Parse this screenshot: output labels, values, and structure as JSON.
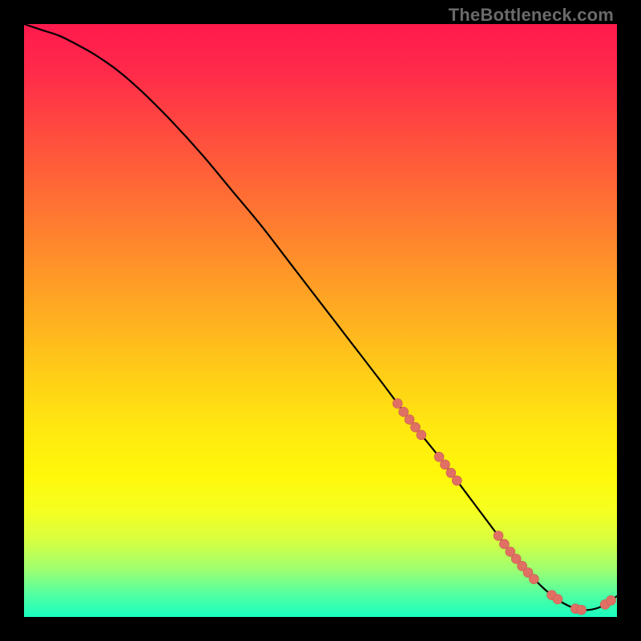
{
  "watermark": "TheBottleneck.com",
  "colors": {
    "page_bg": "#000000",
    "gradient_top": "#ff1a4d",
    "gradient_bottom": "#18ffc0",
    "curve": "#000000",
    "marker_fill": "#e07064",
    "marker_stroke": "#c85a4e"
  },
  "chart_data": {
    "type": "line",
    "title": "",
    "xlabel": "",
    "ylabel": "",
    "xlim": [
      0,
      100
    ],
    "ylim": [
      0,
      100
    ],
    "grid": false,
    "legend": false,
    "series": [
      {
        "name": "curve",
        "x": [
          0,
          3,
          6,
          9,
          12,
          16,
          20,
          25,
          30,
          35,
          40,
          45,
          50,
          55,
          60,
          63,
          66,
          68,
          70,
          73,
          76,
          79,
          82,
          85,
          88,
          91,
          94,
          97,
          100
        ],
        "y": [
          100,
          99,
          98,
          96.5,
          94.8,
          92,
          88.5,
          83.5,
          78,
          72,
          66,
          59.5,
          53,
          46.5,
          40,
          36,
          32,
          29.5,
          27,
          23,
          19,
          15,
          11,
          7.5,
          4.5,
          2.3,
          1.2,
          1.6,
          3.5
        ]
      }
    ],
    "markers": [
      {
        "x": 63,
        "y": 36
      },
      {
        "x": 64,
        "y": 34.6
      },
      {
        "x": 65,
        "y": 33.3
      },
      {
        "x": 66,
        "y": 32
      },
      {
        "x": 67,
        "y": 30.7
      },
      {
        "x": 70,
        "y": 27
      },
      {
        "x": 71,
        "y": 25.7
      },
      {
        "x": 72,
        "y": 24.3
      },
      {
        "x": 73,
        "y": 23
      },
      {
        "x": 80,
        "y": 13.7
      },
      {
        "x": 81,
        "y": 12.3
      },
      {
        "x": 82,
        "y": 11
      },
      {
        "x": 83,
        "y": 9.8
      },
      {
        "x": 84,
        "y": 8.6
      },
      {
        "x": 85,
        "y": 7.5
      },
      {
        "x": 86,
        "y": 6.4
      },
      {
        "x": 89,
        "y": 3.7
      },
      {
        "x": 90,
        "y": 3
      },
      {
        "x": 93,
        "y": 1.4
      },
      {
        "x": 94,
        "y": 1.2
      },
      {
        "x": 98,
        "y": 2.1
      },
      {
        "x": 99,
        "y": 2.8
      }
    ]
  }
}
